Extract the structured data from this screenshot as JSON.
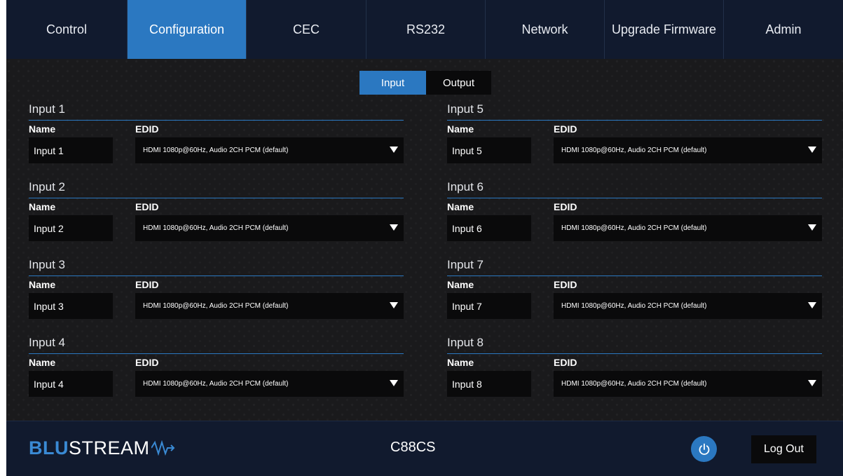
{
  "nav": {
    "tabs": [
      {
        "label": "Control"
      },
      {
        "label": "Configuration"
      },
      {
        "label": "CEC"
      },
      {
        "label": "RS232"
      },
      {
        "label": "Network"
      },
      {
        "label": "Upgrade Firmware"
      },
      {
        "label": "Admin"
      }
    ],
    "active": "Configuration"
  },
  "toggle": {
    "input_label": "Input",
    "output_label": "Output",
    "active": "Input"
  },
  "inputs": [
    {
      "title": "Input 1",
      "name_label": "Name",
      "edid_label": "EDID",
      "name_value": "Input 1",
      "edid_value": "HDMI 1080p@60Hz, Audio 2CH PCM (default)"
    },
    {
      "title": "Input 2",
      "name_label": "Name",
      "edid_label": "EDID",
      "name_value": "Input 2",
      "edid_value": "HDMI 1080p@60Hz, Audio 2CH PCM (default)"
    },
    {
      "title": "Input 3",
      "name_label": "Name",
      "edid_label": "EDID",
      "name_value": "Input 3",
      "edid_value": "HDMI 1080p@60Hz, Audio 2CH PCM (default)"
    },
    {
      "title": "Input 4",
      "name_label": "Name",
      "edid_label": "EDID",
      "name_value": "Input 4",
      "edid_value": "HDMI 1080p@60Hz, Audio 2CH PCM (default)"
    },
    {
      "title": "Input 5",
      "name_label": "Name",
      "edid_label": "EDID",
      "name_value": "Input 5",
      "edid_value": "HDMI 1080p@60Hz, Audio 2CH PCM (default)"
    },
    {
      "title": "Input 6",
      "name_label": "Name",
      "edid_label": "EDID",
      "name_value": "Input 6",
      "edid_value": "HDMI 1080p@60Hz, Audio 2CH PCM (default)"
    },
    {
      "title": "Input 7",
      "name_label": "Name",
      "edid_label": "EDID",
      "name_value": "Input 7",
      "edid_value": "HDMI 1080p@60Hz, Audio 2CH PCM (default)"
    },
    {
      "title": "Input 8",
      "name_label": "Name",
      "edid_label": "EDID",
      "name_value": "Input 8",
      "edid_value": "HDMI 1080p@60Hz, Audio 2CH PCM (default)"
    }
  ],
  "footer": {
    "logo_bold": "BLU",
    "logo_rest": "STREAM",
    "model": "C88CS",
    "power_icon": "power-icon",
    "logout_label": "Log Out"
  },
  "colors": {
    "accent": "#2b78c1",
    "nav_bg": "#111a2e",
    "panel_bg": "#1a1a1c"
  }
}
